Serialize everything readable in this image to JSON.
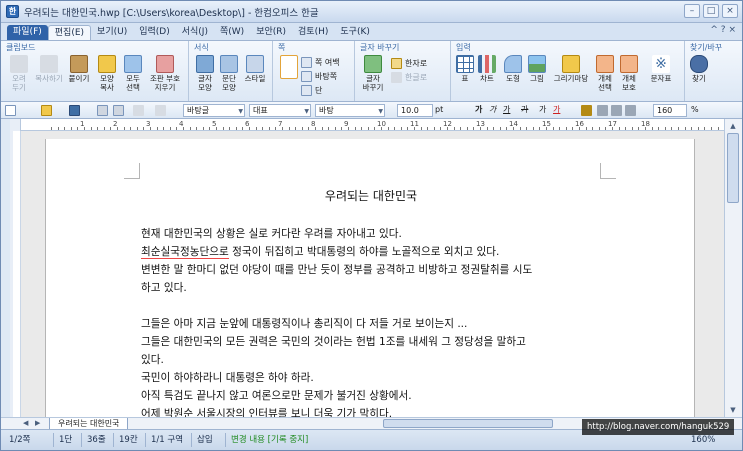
{
  "window": {
    "title": "우려되는 대한민국.hwp [C:\\Users\\korea\\Desktop\\] - 한컴오피스 한글",
    "app_icon_letter": "한"
  },
  "menubar": {
    "items": [
      {
        "label": "파일(F)"
      },
      {
        "label": "편집(E)"
      },
      {
        "label": "보기(U)"
      },
      {
        "label": "입력(D)"
      },
      {
        "label": "서식(J)"
      },
      {
        "label": "쪽(W)"
      },
      {
        "label": "보안(R)"
      },
      {
        "label": "검토(H)"
      },
      {
        "label": "도구(K)"
      }
    ],
    "right_controls": "^ ? ×"
  },
  "ribbon": {
    "clipboard": {
      "title": "클립보드",
      "cut": "오려\n두기",
      "copy": "복사하기",
      "paste": "붙이기",
      "format_copy": "모양\n복사",
      "select_all": "모두\n선택",
      "condition_protect": "조판 부호\n지우기"
    },
    "format": {
      "title": "서식",
      "char_shape": "글자\n모양",
      "para_shape": "문단\n모양",
      "style": "스타일"
    },
    "page": {
      "title": "쪽",
      "page_margin": "쪽 여백",
      "bg": "바탕쪽",
      "columns": "단"
    },
    "char_change": {
      "title": "글자 바꾸기",
      "char_change": "글자\n바꾸기",
      "hanja": "한자로",
      "hangul": "한글로"
    },
    "insert": {
      "title": "입력",
      "table": "표",
      "chart": "차트",
      "shape": "도형",
      "picture": "그림",
      "drawing": "그리기마당",
      "object_select": "개체\n선택",
      "object_protect": "개체\n보호",
      "symbol": "문자표"
    },
    "find": {
      "title": "찾기/바꾸",
      "find": "찾기"
    }
  },
  "format_toolbar": {
    "font_lang": "바탕글",
    "style": "대표",
    "font": "바탕",
    "size": "10.0",
    "unit": "pt",
    "zoom": "160",
    "zoom_unit": "%",
    "bold": "가",
    "italic": "가",
    "underline": "가",
    "strike": "가",
    "color_a": "가",
    "color_b": "가"
  },
  "ruler": {
    "numbers": [
      "1",
      "2",
      "3",
      "4",
      "5",
      "6",
      "7",
      "8",
      "9",
      "10",
      "11",
      "12",
      "13",
      "14",
      "15",
      "16",
      "17",
      "18"
    ]
  },
  "document": {
    "title": "우려되는 대한민국",
    "paragraphs": [
      "현재 대한민국의 상황은 실로 커다란 우려를 자아내고 있다.",
      "최순실국정농단으로 정국이 뒤집히고 박대통령의 하야를 노골적으로 외치고 있다.",
      "변변한 말 한마디 없던 야당이 때를 만난 듯이 정부를 공격하고 비방하고 정권탈취를 시도",
      "하고 있다.",
      "",
      "그들은 아마 지금 눈앞에 대통령직이나 총리직이 다 저들 거로 보이는지 ...",
      "그들은 대한민국의 모든 권력은 국민의 것이라는 헌법 1조를 내세워 그 정당성을 말하고",
      "있다.",
      "국민이 하야하라니 대통령은 하야 하라.",
      "아직 특검도 끝나지 않고 여론으로만 문제가 불거진 상황에서.",
      "어제 박원순 서울시장의 인터뷰를 보니 더욱 기가 막히다."
    ]
  },
  "tabs": {
    "doc_tab": "우려되는 대한민국"
  },
  "statusbar": {
    "page": "1/2쪽",
    "section": "1단",
    "line": "36줄",
    "col": "19칸",
    "zone": "1/1 구역",
    "mode": "삽입",
    "track": "변경 내용 [기록 중지]",
    "zoom": "160%"
  },
  "overlay": {
    "url": "http://blog.naver.com/hanguk529"
  },
  "colors": {
    "accent": "#2f62a8",
    "ribbon_group_title": "#3b6aa6",
    "spell_underline": "#e44444",
    "status_green": "#1f8a1f"
  }
}
